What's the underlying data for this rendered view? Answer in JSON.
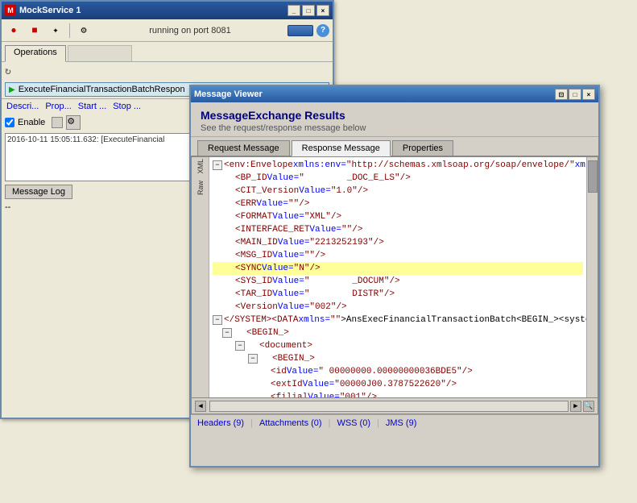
{
  "mainWindow": {
    "title": "MockService 1",
    "status": "running on port 8081"
  },
  "tabs": {
    "main": [
      {
        "label": "Operations",
        "active": true
      }
    ]
  },
  "toolbar": {
    "help": "?",
    "status_label": "running on port 8081"
  },
  "operationItem": {
    "label": "ExecuteFinancialTransactionBatchRespon"
  },
  "bottomTabs": [
    "Descri...",
    "Prop...",
    "Start ...",
    "Stop ..."
  ],
  "checkboxLabel": "Enable",
  "logText": "2016-10-11 15:05:11.632: [ExecuteFinancial",
  "messageLogBtn": "Message Log",
  "dash": "--",
  "messageViewer": {
    "title": "Message Viewer",
    "heading": "MessageExchange Results",
    "subheading": "See the request/response message below",
    "tabs": [
      {
        "label": "Request Message",
        "active": false
      },
      {
        "label": "Response Message",
        "active": true
      },
      {
        "label": "Properties",
        "active": false
      }
    ],
    "sideLabels": [
      "XML",
      "Raw"
    ],
    "xmlLines": [
      {
        "indent": 0,
        "expand": true,
        "content": "<env:Envelope xmlns:env=\"http://schemas.xmlsoap.org/soap/envelope/\" xmlns:wsa=\"http",
        "highlighted": false
      },
      {
        "indent": 1,
        "expand": false,
        "content": "<BP_ID Value=\"        _DOC_E_LS\"/>",
        "highlighted": false
      },
      {
        "indent": 1,
        "expand": false,
        "content": "<CIT_Version Value=\"1.0\"/>",
        "highlighted": false
      },
      {
        "indent": 1,
        "expand": false,
        "content": "<ERR Value=\"\"/>",
        "highlighted": false
      },
      {
        "indent": 1,
        "expand": false,
        "content": "<FORMAT Value=\"XML\"/>",
        "highlighted": false
      },
      {
        "indent": 1,
        "expand": false,
        "content": "<INTERFACE_RET Value=\"\"/>",
        "highlighted": false
      },
      {
        "indent": 1,
        "expand": false,
        "content": "<MAIN_ID Value=\"2213252193\"/>",
        "highlighted": false
      },
      {
        "indent": 1,
        "expand": false,
        "content": "<MSG_ID Value=\"\"/>",
        "highlighted": false
      },
      {
        "indent": 1,
        "expand": false,
        "content": "<SYNC Value=\"N\"/>",
        "highlighted": true
      },
      {
        "indent": 1,
        "expand": false,
        "content": "<SYS_ID Value=\"        _DOCUM\"/>",
        "highlighted": false
      },
      {
        "indent": 1,
        "expand": false,
        "content": "<TAR_ID Value=\"        DISTR\"/>",
        "highlighted": false
      },
      {
        "indent": 1,
        "expand": false,
        "content": "<Version Value=\"002\"/>",
        "highlighted": false
      },
      {
        "indent": 0,
        "expand": true,
        "content": "</SYSTEM><DATA xmlns=\"\">AnsExecFinancialTransactionBatch<BEGIN_><systemTo",
        "highlighted": false
      },
      {
        "indent": 2,
        "expand": true,
        "content": "<BEGIN_>",
        "highlighted": false
      },
      {
        "indent": 3,
        "expand": true,
        "content": "<document>",
        "highlighted": false
      },
      {
        "indent": 4,
        "expand": true,
        "content": "<BEGIN_>",
        "highlighted": false
      },
      {
        "indent": 5,
        "expand": false,
        "content": "<id Value=\" 00000000.00000000036BDE5\"/>",
        "highlighted": false
      },
      {
        "indent": 5,
        "expand": false,
        "content": "<extId Value=\"00000J00.3787522620\"/>",
        "highlighted": false
      },
      {
        "indent": 5,
        "expand": false,
        "content": "<filial Value=\"001\"/>",
        "highlighted": false
      }
    ],
    "footer": {
      "headers": "Headers (9)",
      "attachments": "Attachments (0)",
      "wss": "WSS (0)",
      "jms": "JMS (9)"
    }
  }
}
